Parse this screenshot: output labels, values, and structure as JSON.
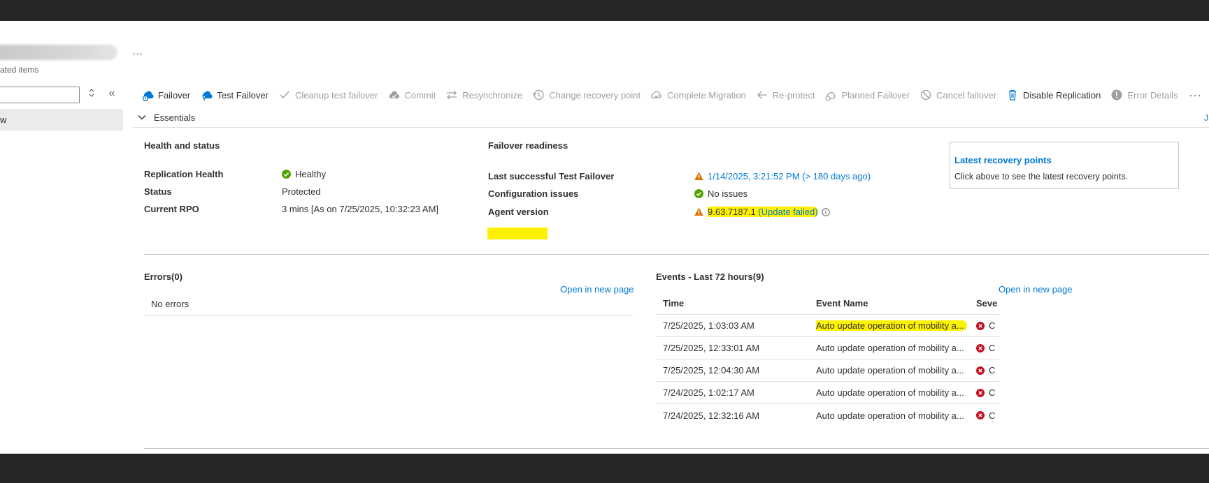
{
  "blade": {
    "subtitle": "ated items",
    "more": "...",
    "selected_item": "w"
  },
  "toolbar": {
    "buttons": [
      {
        "label": "Failover",
        "icon": "failover-icon",
        "enabled": true
      },
      {
        "label": "Test Failover",
        "icon": "test-failover-icon",
        "enabled": true
      },
      {
        "label": "Cleanup test failover",
        "icon": "check-icon",
        "enabled": false
      },
      {
        "label": "Commit",
        "icon": "commit-icon",
        "enabled": false
      },
      {
        "label": "Resynchronize",
        "icon": "resync-icon",
        "enabled": false
      },
      {
        "label": "Change recovery point",
        "icon": "history-icon",
        "enabled": false
      },
      {
        "label": "Complete Migration",
        "icon": "cloud-icon",
        "enabled": false
      },
      {
        "label": "Re-protect",
        "icon": "arrow-left-icon",
        "enabled": false
      },
      {
        "label": "Planned Failover",
        "icon": "planned-failover-icon",
        "enabled": false
      },
      {
        "label": "Cancel failover",
        "icon": "cancel-icon",
        "enabled": false
      },
      {
        "label": "Disable Replication",
        "icon": "trash-icon",
        "enabled": true
      },
      {
        "label": "Error Details",
        "icon": "error-info-icon",
        "enabled": false
      }
    ],
    "more": "···"
  },
  "essentials": {
    "label": "Essentials",
    "json_view": "J"
  },
  "health": {
    "title": "Health and status",
    "rows": [
      {
        "label": "Replication Health",
        "value": "Healthy"
      },
      {
        "label": "Status",
        "value": "Protected"
      },
      {
        "label": "Current RPO",
        "value": "3 mins [As on 7/25/2025, 10:32:23 AM]"
      }
    ]
  },
  "failover": {
    "title": "Failover readiness",
    "rows": [
      {
        "label": "Last successful Test Failover",
        "value": "1/14/2025, 3:21:52 PM (> 180 days ago)"
      },
      {
        "label": "Configuration issues",
        "value": "No issues"
      },
      {
        "label": "Agent version",
        "value_part1": "9.63.7187.1",
        "value_part2": " (Update failed)"
      }
    ]
  },
  "recovery": {
    "title": "Latest recovery points",
    "text": "Click above to see the latest recovery points."
  },
  "errors": {
    "title": "Errors(0)",
    "open_link": "Open in new page",
    "empty": "No errors"
  },
  "events": {
    "title": "Events - Last 72 hours(9)",
    "open_link": "Open in new page",
    "columns": [
      "Time",
      "Event Name",
      "Seve"
    ],
    "rows": [
      {
        "time": "7/25/2025, 1:03:03 AM",
        "name": "Auto update operation of mobility a...",
        "sev": "C"
      },
      {
        "time": "7/25/2025, 12:33:01 AM",
        "name": "Auto update operation of mobility a...",
        "sev": "C"
      },
      {
        "time": "7/25/2025, 12:04:30 AM",
        "name": "Auto update operation of mobility a...",
        "sev": "C"
      },
      {
        "time": "7/24/2025, 1:02:17 AM",
        "name": "Auto update operation of mobility a...",
        "sev": "C"
      },
      {
        "time": "7/24/2025, 12:32:16 AM",
        "name": "Auto update operation of mobility a...",
        "sev": "C"
      }
    ]
  },
  "colors": {
    "accent": "#0078d4",
    "healthy": "#57a300",
    "warning": "#db7500",
    "error": "#c50f1f",
    "highlight": "#fff200"
  }
}
